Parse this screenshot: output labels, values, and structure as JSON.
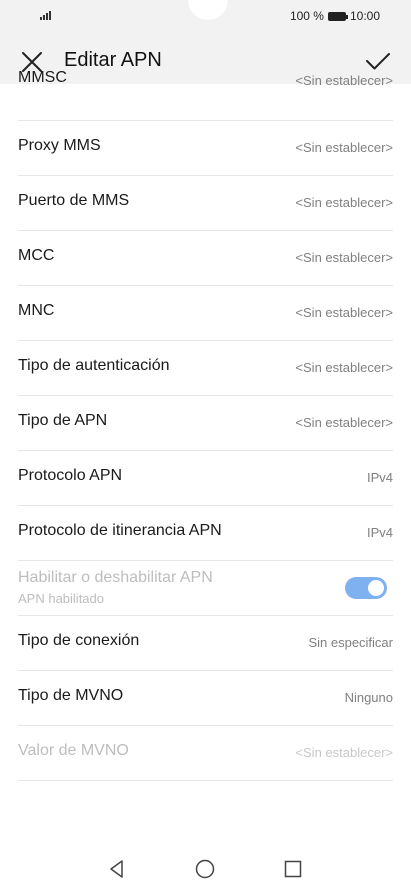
{
  "status_bar": {
    "battery_percent": "100 %",
    "time": "10:00",
    "battery_level": 1.0
  },
  "app_bar": {
    "title": "Editar APN"
  },
  "settings": [
    {
      "label": "MMSC",
      "value": "<Sin establecer>"
    },
    {
      "label": "Proxy MMS",
      "value": "<Sin establecer>"
    },
    {
      "label": "Puerto de MMS",
      "value": "<Sin establecer>"
    },
    {
      "label": "MCC",
      "value": "<Sin establecer>"
    },
    {
      "label": "MNC",
      "value": "<Sin establecer>"
    },
    {
      "label": "Tipo de autenticación",
      "value": "<Sin establecer>"
    },
    {
      "label": "Tipo de APN",
      "value": "<Sin establecer>"
    },
    {
      "label": "Protocolo APN",
      "value": "IPv4"
    },
    {
      "label": "Protocolo de itinerancia APN",
      "value": "IPv4"
    }
  ],
  "apn_toggle": {
    "label": "Habilitar o deshabilitar APN",
    "sublabel": "APN habilitado",
    "enabled": true,
    "disabled_style": true
  },
  "settings_after": [
    {
      "label": "Tipo de conexión",
      "value": "Sin especificar"
    },
    {
      "label": "Tipo de MVNO",
      "value": "Ninguno"
    },
    {
      "label": "Valor de MVNO",
      "value": "<Sin establecer>",
      "disabled": true
    }
  ],
  "colors": {
    "accent": "#7fb0ef",
    "app_bar_bg": "#f2f2f2",
    "value_text": "#808080",
    "disabled_text": "#bdbdbd"
  }
}
